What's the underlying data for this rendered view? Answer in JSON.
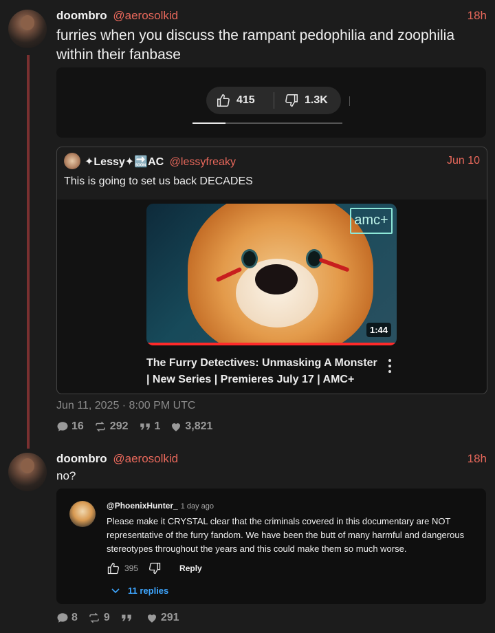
{
  "post1": {
    "author": "doombro",
    "handle": "@aerosolkid",
    "time": "18h",
    "text": "furries when you discuss the rampant pedophilia and zoophilia within their fanbase",
    "video": {
      "likes": "415",
      "dislikes": "1.3K",
      "progress": 0.22
    },
    "quote": {
      "author": "✦Lessy✦🔜AC",
      "handle": "@lessyfreaky",
      "time": "Jun 10",
      "text": "This is going to set us back DECADES",
      "embed": {
        "logo": "amc+",
        "duration": "1:44",
        "title": "The Furry Detectives: Unmasking A Monster | New Series | Premieres July 17 | AMC+"
      }
    },
    "timestamp": "Jun 11, 2025 · 8:00 PM UTC",
    "stats": {
      "replies": "16",
      "reposts": "292",
      "quotes": "1",
      "likes": "3,821"
    }
  },
  "post2": {
    "author": "doombro",
    "handle": "@aerosolkid",
    "time": "18h",
    "text": "no?",
    "comment": {
      "user": "@PhoenixHunter_",
      "ago": "1 day ago",
      "text": "Please make it CRYSTAL clear that the criminals covered in this documentary are NOT representative of the furry fandom. We have been the butt of many harmful and dangerous stereotypes throughout the years and this could make them so much worse.",
      "likes": "395",
      "reply_label": "Reply",
      "replies_label": "11 replies"
    },
    "stats": {
      "replies": "8",
      "reposts": "9",
      "quotes": "",
      "likes": "291"
    }
  },
  "colors": {
    "accent": "#e8685b",
    "thread": "#7a3030",
    "link": "#3ea6ff"
  }
}
